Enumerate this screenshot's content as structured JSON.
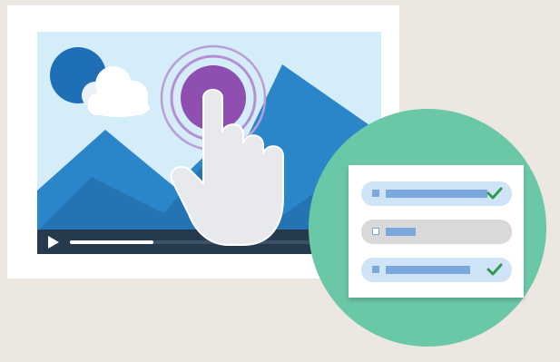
{
  "scene": {
    "description_free": true
  },
  "video_player": {
    "progress": 0.28,
    "colors": {
      "sky": "#d5ecf9",
      "mountain": "#2b86c9",
      "controls": "#253a4d",
      "tap_ring": "#8e4fb0"
    }
  },
  "checklist": {
    "items": [
      {
        "state": "selected",
        "checked": true,
        "bar_fill": 0.75
      },
      {
        "state": "unselected",
        "checked": false,
        "bar_fill": 0.22
      },
      {
        "state": "selected",
        "checked": true,
        "bar_fill": 0.62
      }
    ],
    "colors": {
      "badge": "#6ac8a7",
      "row_selected": "#cfe4f7",
      "row_unselected": "#d9d9d9",
      "bar": "#7aa7dc",
      "check": "#2f9a4e"
    }
  },
  "icons": [
    "play-icon",
    "hand-pointer-icon",
    "tap-ripple-icon",
    "sun-icon",
    "cloud-icon",
    "check-icon"
  ]
}
